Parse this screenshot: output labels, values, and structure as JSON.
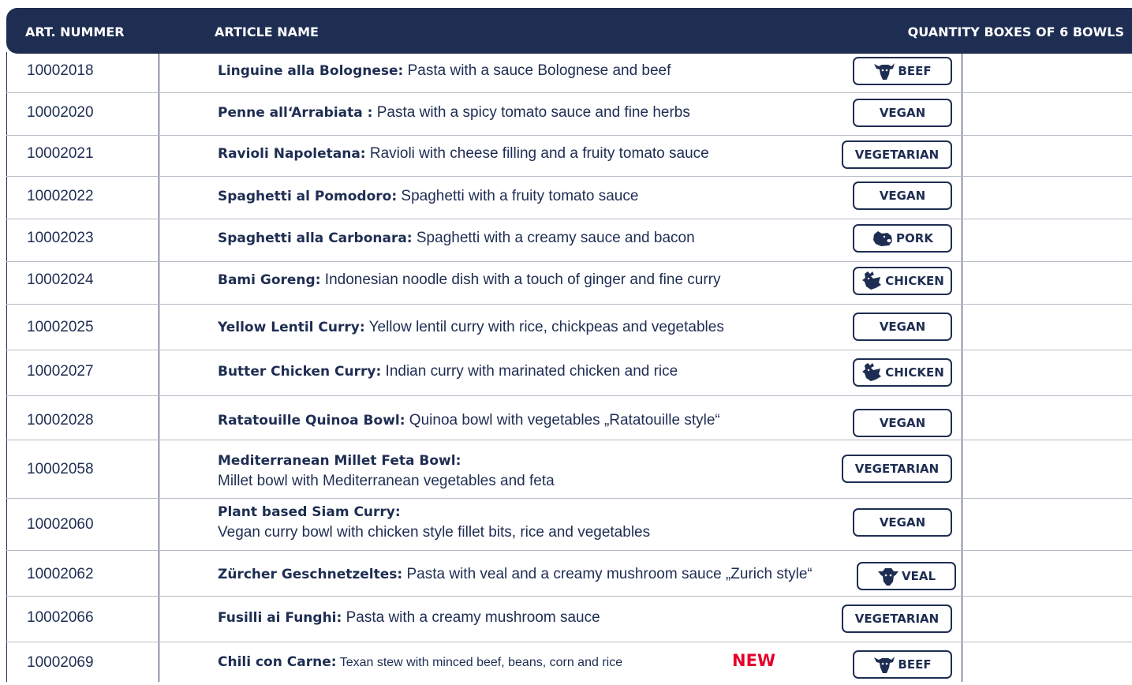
{
  "header": {
    "art_number": "ART. NUMMER",
    "article_name": "ARTICLE NAME",
    "quantity": "QUANTITY BOXES OF 6 BOWLS"
  },
  "colors": {
    "navy": "#1e2d52",
    "new_red": "#e4002b"
  },
  "rows": [
    {
      "art": "10002018",
      "name": "Linguine alla Bolognese:",
      "desc": " Pasta with a sauce Bolognese and beef",
      "badge": "BEEF",
      "icon": "cow-icon"
    },
    {
      "art": "10002020",
      "name": "Penne all‘Arrabiata :",
      "desc": " Pasta with a spicy tomato sauce and fine herbs",
      "badge": "VEGAN",
      "icon": ""
    },
    {
      "art": "10002021",
      "name": "Ravioli Napoletana:",
      "desc": " Ravioli with cheese filling and a fruity tomato sauce",
      "badge": "VEGETARIAN",
      "icon": ""
    },
    {
      "art": "10002022",
      "name": "Spaghetti al Pomodoro:",
      "desc": " Spaghetti with a fruity tomato sauce",
      "badge": "VEGAN",
      "icon": ""
    },
    {
      "art": "10002023",
      "name": "Spaghetti alla Carbonara:",
      "desc": " Spaghetti with a creamy sauce and bacon",
      "badge": "PORK",
      "icon": "pig-icon"
    },
    {
      "art": "10002024",
      "name": "Bami Goreng:",
      "desc": " Indonesian noodle dish with a touch of ginger and fine curry",
      "badge": "CHICKEN",
      "icon": "chicken-icon"
    },
    {
      "art": "10002025",
      "name": "Yellow Lentil Curry:",
      "desc": " Yellow lentil curry with rice, chickpeas and vegetables",
      "badge": "VEGAN",
      "icon": ""
    },
    {
      "art": "10002027",
      "name": "Butter Chicken Curry:",
      "desc": " Indian curry with marinated chicken and rice",
      "badge": "CHICKEN",
      "icon": "chicken-icon"
    },
    {
      "art": "10002028",
      "name": "Ratatouille Quinoa Bowl:",
      "desc": " Quinoa bowl with vegetables „Ratatouille style“",
      "badge": "VEGAN",
      "icon": ""
    },
    {
      "art": "10002058",
      "name": "Mediterranean Millet Feta Bowl:",
      "desc": "Millet bowl with Mediterranean vegetables and feta",
      "badge": "VEGETARIAN",
      "icon": ""
    },
    {
      "art": "10002060",
      "name": "Plant based Siam Curry:",
      "desc": "Vegan curry bowl with chicken style fillet bits, rice and vegetables",
      "badge": "VEGAN",
      "icon": ""
    },
    {
      "art": "10002062",
      "name": "Zürcher Geschnetzeltes:",
      "desc": " Pasta with veal and a creamy mushroom sauce „Zurich style“",
      "badge": "VEAL",
      "icon": "calf-icon"
    },
    {
      "art": "10002066",
      "name": "Fusilli ai Funghi:",
      "desc": " Pasta with a creamy mushroom sauce",
      "badge": "VEGETARIAN",
      "icon": ""
    },
    {
      "art": "10002069",
      "name": "Chili con Carne:",
      "desc": " Texan stew with minced beef, beans, corn and rice",
      "badge": "BEEF",
      "icon": "cow-icon",
      "new_label": "NEW"
    }
  ]
}
